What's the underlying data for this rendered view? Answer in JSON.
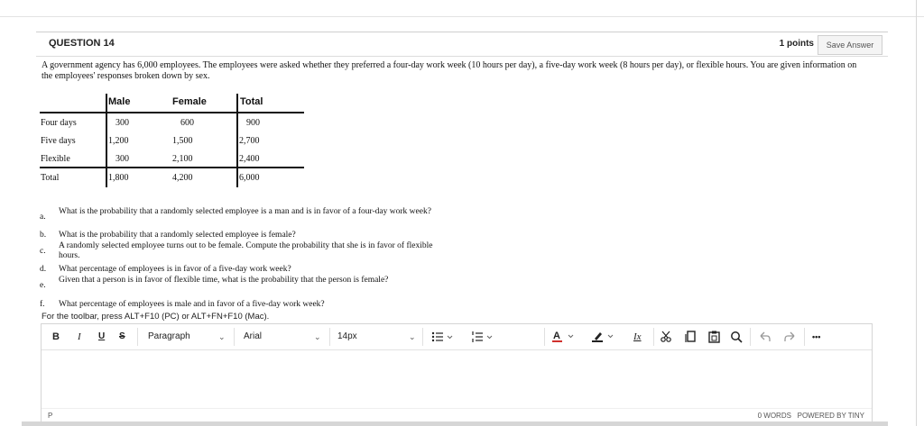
{
  "question": {
    "title": "QUESTION 14",
    "points": "1 points",
    "save_label": "Save Answer",
    "intro": "A government agency has 6,000 employees. The employees were asked whether they preferred a four-day work week (10 hours per day), a five-day work week (8 hours per day), or flexible hours. You are given information on the employees' responses broken down by sex."
  },
  "table": {
    "headers": [
      "Male",
      "Female",
      "Total"
    ],
    "rows": [
      {
        "label": "Four days",
        "male": "300",
        "female": "600",
        "total": "900"
      },
      {
        "label": "Five days",
        "male": "1,200",
        "female": "1,500",
        "total": "2,700"
      },
      {
        "label": "Flexible",
        "male": "300",
        "female": "2,100",
        "total": "2,400"
      },
      {
        "label": "Total",
        "male": "1,800",
        "female": "4,200",
        "total": "6,000"
      }
    ]
  },
  "parts": [
    {
      "label": "a.",
      "text": "What is the probability that a randomly selected employee is a man and is in favor of a four-day work week?"
    },
    {
      "label": "b.",
      "text": "What is the probability that a randomly selected employee is female?"
    },
    {
      "label": "c.",
      "text": "A randomly selected employee turns out to be female. Compute the probability that she is in favor of flexible hours."
    },
    {
      "label": "d.",
      "text": "What percentage of employees is in favor of a five-day work week?"
    },
    {
      "label": "e.",
      "text": "Given that a person is in favor of flexible time, what is the probability that the person is female?"
    },
    {
      "label": "f.",
      "text": "What percentage of employees is male and in favor of a five-day work week?"
    }
  ],
  "editor": {
    "hint": "For the toolbar, press ALT+F10 (PC) or ALT+FN+F10 (Mac).",
    "bold": "B",
    "italic": "I",
    "underline": "U",
    "strike": "S",
    "block_format": "Paragraph",
    "font_family": "Arial",
    "font_size": "14px",
    "clear_format": "Ix",
    "more": "•••",
    "path": "P",
    "word_count": "0 WORDS",
    "powered_by": "POWERED BY TINY",
    "icons": [
      "bullet-list-icon",
      "numbered-list-icon",
      "text-color-icon",
      "highlight-icon",
      "clear-formatting-icon",
      "cut-icon",
      "copy-icon",
      "paste-icon",
      "search-icon",
      "undo-icon",
      "redo-icon"
    ]
  }
}
